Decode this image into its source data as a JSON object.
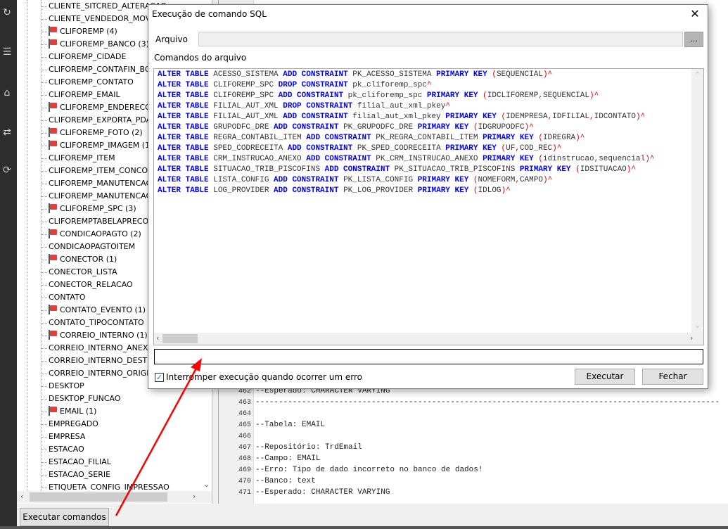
{
  "leftbar": {
    "icons": [
      "refresh-icon",
      "list-icon",
      "home-icon",
      "transfer-icon",
      "sync-icon"
    ]
  },
  "tree": {
    "items": [
      {
        "label": "CLIENTE_SITCRED_ALTERACAO",
        "flag": false
      },
      {
        "label": "CLIENTE_VENDEDOR_MOV",
        "flag": false
      },
      {
        "label": "CLIFOREMP (4)",
        "flag": true
      },
      {
        "label": "CLIFOREMP_BANCO (3)",
        "flag": true
      },
      {
        "label": "CLIFOREMP_CIDADE",
        "flag": false
      },
      {
        "label": "CLIFOREMP_CONTAFIN_BO",
        "flag": false
      },
      {
        "label": "CLIFOREMP_CONTATO",
        "flag": false
      },
      {
        "label": "CLIFOREMP_EMAIL",
        "flag": false
      },
      {
        "label": "CLIFOREMP_ENDERECO",
        "flag": true
      },
      {
        "label": "CLIFOREMP_EXPORTA_PDA",
        "flag": false
      },
      {
        "label": "CLIFOREMP_FOTO (2)",
        "flag": true
      },
      {
        "label": "CLIFOREMP_IMAGEM (1",
        "flag": true
      },
      {
        "label": "CLIFOREMP_ITEM",
        "flag": false
      },
      {
        "label": "CLIFOREMP_ITEM_CONCO",
        "flag": false
      },
      {
        "label": "CLIFOREMP_MANUTENCAO",
        "flag": false
      },
      {
        "label": "CLIFOREMP_MANUTENCAO",
        "flag": false
      },
      {
        "label": "CLIFOREMP_SPC (3)",
        "flag": true
      },
      {
        "label": "CLIFOREMPTABELAPRECO",
        "flag": false
      },
      {
        "label": "CONDICAOPAGTO (2)",
        "flag": true
      },
      {
        "label": "CONDICAOPAGTOITEM",
        "flag": false
      },
      {
        "label": "CONECTOR (1)",
        "flag": true
      },
      {
        "label": "CONECTOR_LISTA",
        "flag": false
      },
      {
        "label": "CONECTOR_RELACAO",
        "flag": false
      },
      {
        "label": "CONTATO",
        "flag": false
      },
      {
        "label": "CONTATO_EVENTO (1)",
        "flag": true
      },
      {
        "label": "CONTATO_TIPOCONTATO",
        "flag": false
      },
      {
        "label": "CORREIO_INTERNO (1)",
        "flag": true
      },
      {
        "label": "CORREIO_INTERNO_ANEXO",
        "flag": false
      },
      {
        "label": "CORREIO_INTERNO_DESTIN",
        "flag": false
      },
      {
        "label": "CORREIO_INTERNO_ORIGE",
        "flag": false
      },
      {
        "label": "DESKTOP",
        "flag": false
      },
      {
        "label": "DESKTOP_FUNCAO",
        "flag": false
      },
      {
        "label": "EMAIL (1)",
        "flag": true
      },
      {
        "label": "EMPREGADO",
        "flag": false
      },
      {
        "label": "EMPRESA",
        "flag": false
      },
      {
        "label": "ESTACAO",
        "flag": false
      },
      {
        "label": "ESTACAO_FILIAL",
        "flag": false
      },
      {
        "label": "ESTACAO_SERIE",
        "flag": false
      },
      {
        "label": "ETIQUETA_CONFIG_IMPRESSAO",
        "flag": false
      }
    ],
    "flag_color": "#d9423e"
  },
  "bottom": {
    "execute_commands_label": "Executar comandos"
  },
  "editor": {
    "lines": [
      {
        "num": "462",
        "text": "--Esperado: CHARACTER VARYING"
      },
      {
        "num": "463",
        "text": "----------------------------------------------------------------------------------------------------"
      },
      {
        "num": "464",
        "text": ""
      },
      {
        "num": "465",
        "text": "--Tabela: EMAIL"
      },
      {
        "num": "466",
        "text": ""
      },
      {
        "num": "467",
        "text": "--Repositório: TrdEmail"
      },
      {
        "num": "468",
        "text": "--Campo: EMAIL"
      },
      {
        "num": "469",
        "text": "--Erro: Tipo de dado incorreto no banco de dados!"
      },
      {
        "num": "470",
        "text": "--Banco: text"
      },
      {
        "num": "471",
        "text": "--Esperado: CHARACTER VARYING"
      }
    ]
  },
  "dialog": {
    "title": "Execução de comando SQL",
    "arquivo_label": "Arquivo",
    "arquivo_value": "",
    "browse_label": "...",
    "comandos_label": "Comandos do arquivo",
    "status_value": "",
    "checkbox_label": "Interromper execução quando ocorrer um erro",
    "checkbox_checked": true,
    "execute_label": "Executar",
    "close_label": "Fechar",
    "keyword_color": "#0000ff",
    "sql_lines": [
      [
        [
          "kw",
          "ALTER TABLE"
        ],
        [
          "t",
          " ACESSO_SISTEMA "
        ],
        [
          "kw",
          "ADD CONSTRAINT"
        ],
        [
          "t",
          " PK_ACESSO_SISTEMA "
        ],
        [
          "kw",
          "PRIMARY KEY"
        ],
        [
          "t",
          " "
        ],
        [
          "op",
          "("
        ],
        [
          "t",
          "SEQUENCIAL"
        ],
        [
          "op",
          ")^"
        ]
      ],
      [
        [
          "kw",
          "ALTER TABLE"
        ],
        [
          "t",
          " CLIFOREMP_SPC "
        ],
        [
          "kw",
          "DROP CONSTRAINT"
        ],
        [
          "t",
          " pk_cliforemp_spc"
        ],
        [
          "op",
          "^"
        ]
      ],
      [
        [
          "kw",
          "ALTER TABLE"
        ],
        [
          "t",
          " CLIFOREMP_SPC "
        ],
        [
          "kw",
          "ADD CONSTRAINT"
        ],
        [
          "t",
          " pk_cliforemp_spc "
        ],
        [
          "kw",
          "PRIMARY KEY"
        ],
        [
          "t",
          " "
        ],
        [
          "op",
          "("
        ],
        [
          "t",
          "IDCLIFOREMP"
        ],
        [
          "op",
          ","
        ],
        [
          "t",
          "SEQUENCIAL"
        ],
        [
          "op",
          ")^"
        ]
      ],
      [
        [
          "kw",
          "ALTER TABLE"
        ],
        [
          "t",
          " FILIAL_AUT_XML "
        ],
        [
          "kw",
          "DROP CONSTRAINT"
        ],
        [
          "t",
          " filial_aut_xml_pkey"
        ],
        [
          "op",
          "^"
        ]
      ],
      [
        [
          "kw",
          "ALTER TABLE"
        ],
        [
          "t",
          " FILIAL_AUT_XML "
        ],
        [
          "kw",
          "ADD CONSTRAINT"
        ],
        [
          "t",
          " filial_aut_xml_pkey "
        ],
        [
          "kw",
          "PRIMARY KEY"
        ],
        [
          "t",
          " "
        ],
        [
          "op",
          "("
        ],
        [
          "t",
          "IDEMPRESA"
        ],
        [
          "op",
          ","
        ],
        [
          "t",
          "IDFILIAL"
        ],
        [
          "op",
          ","
        ],
        [
          "t",
          "IDCONTATO"
        ],
        [
          "op",
          ")^"
        ]
      ],
      [
        [
          "kw",
          "ALTER TABLE"
        ],
        [
          "t",
          " GRUPODFC_DRE "
        ],
        [
          "kw",
          "ADD CONSTRAINT"
        ],
        [
          "t",
          " PK_GRUPODFC_DRE "
        ],
        [
          "kw",
          "PRIMARY KEY"
        ],
        [
          "t",
          " "
        ],
        [
          "op",
          "("
        ],
        [
          "t",
          "IDGRUPODFC"
        ],
        [
          "op",
          ")^"
        ]
      ],
      [
        [
          "kw",
          "ALTER TABLE"
        ],
        [
          "t",
          " REGRA_CONTABIL_ITEM "
        ],
        [
          "kw",
          "ADD CONSTRAINT"
        ],
        [
          "t",
          " PK_REGRA_CONTABIL_ITEM "
        ],
        [
          "kw",
          "PRIMARY KEY"
        ],
        [
          "t",
          " "
        ],
        [
          "op",
          "("
        ],
        [
          "t",
          "IDREGRA"
        ],
        [
          "op",
          ")^"
        ]
      ],
      [
        [
          "kw",
          "ALTER TABLE"
        ],
        [
          "t",
          " SPED_CODRECEITA "
        ],
        [
          "kw",
          "ADD CONSTRAINT"
        ],
        [
          "t",
          " PK_SPED_CODRECEITA "
        ],
        [
          "kw",
          "PRIMARY KEY"
        ],
        [
          "t",
          " "
        ],
        [
          "op",
          "("
        ],
        [
          "t",
          "UF"
        ],
        [
          "op",
          ","
        ],
        [
          "t",
          "COD_REC"
        ],
        [
          "op",
          ")^"
        ]
      ],
      [
        [
          "kw",
          "ALTER TABLE"
        ],
        [
          "t",
          " CRM_INSTRUCAO_ANEXO "
        ],
        [
          "kw",
          "ADD CONSTRAINT"
        ],
        [
          "t",
          " PK_CRM_INSTRUCAO_ANEXO "
        ],
        [
          "kw",
          "PRIMARY KEY"
        ],
        [
          "t",
          " "
        ],
        [
          "op",
          "("
        ],
        [
          "t",
          "idinstrucao"
        ],
        [
          "op",
          ","
        ],
        [
          "t",
          "sequencial"
        ],
        [
          "op",
          ")^"
        ]
      ],
      [
        [
          "kw",
          "ALTER TABLE"
        ],
        [
          "t",
          " SITUACAO_TRIB_PISCOFINS "
        ],
        [
          "kw",
          "ADD CONSTRAINT"
        ],
        [
          "t",
          " PK_SITUACAO_TRIB_PISCOFINS "
        ],
        [
          "kw",
          "PRIMARY KEY"
        ],
        [
          "t",
          " "
        ],
        [
          "op",
          "("
        ],
        [
          "t",
          "IDSITUACAO"
        ],
        [
          "op",
          ")^"
        ]
      ],
      [
        [
          "kw",
          "ALTER TABLE"
        ],
        [
          "t",
          " LISTA_CONFIG "
        ],
        [
          "kw",
          "ADD CONSTRAINT"
        ],
        [
          "t",
          " PK_LISTA_CONFIG "
        ],
        [
          "kw",
          "PRIMARY KEY"
        ],
        [
          "t",
          " "
        ],
        [
          "op",
          "("
        ],
        [
          "t",
          "NOMEFORM"
        ],
        [
          "op",
          ","
        ],
        [
          "t",
          "CAMPO"
        ],
        [
          "op",
          ")^"
        ]
      ],
      [
        [
          "kw",
          "ALTER TABLE"
        ],
        [
          "t",
          " LOG_PROVIDER "
        ],
        [
          "kw",
          "ADD CONSTRAINT"
        ],
        [
          "t",
          " PK_LOG_PROVIDER "
        ],
        [
          "kw",
          "PRIMARY KEY"
        ],
        [
          "t",
          " "
        ],
        [
          "op",
          "("
        ],
        [
          "t",
          "IDLOG"
        ],
        [
          "op",
          ")^"
        ]
      ]
    ]
  },
  "annotation": {
    "arrow_color": "#ff0000"
  }
}
